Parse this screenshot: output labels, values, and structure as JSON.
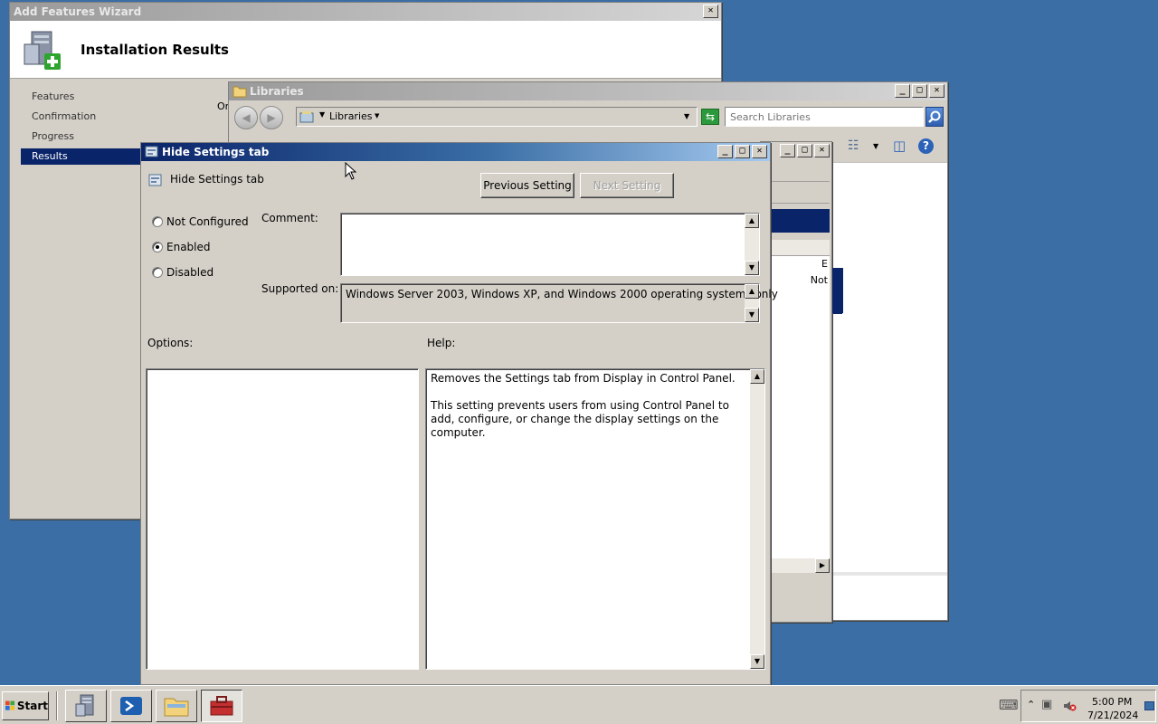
{
  "wizard": {
    "title": "Add Features Wizard",
    "heading": "Installation Results",
    "nav": [
      "Features",
      "Confirmation",
      "Progress",
      "Results"
    ],
    "selected_index": 3,
    "partial_text": "Or"
  },
  "libraries": {
    "title": "Libraries",
    "address_crumb": "Libraries",
    "search_placeholder": "Search Libraries"
  },
  "back_window": {
    "col_text_e": "E",
    "col_text_not": "Not"
  },
  "policy": {
    "title": "Hide Settings tab",
    "setting_name": "Hide Settings tab",
    "prev_button": "Previous Setting",
    "next_button": "Next Setting",
    "radio_options": [
      "Not Configured",
      "Enabled",
      "Disabled"
    ],
    "selected_option": "Enabled",
    "comment_label": "Comment:",
    "comment_value": "",
    "supported_label": "Supported on:",
    "supported_value": "Windows Server 2003, Windows XP, and Windows 2000 operating systems only",
    "options_label": "Options:",
    "help_label": "Help:",
    "help_line1": "Removes the Settings tab from Display in Control Panel.",
    "help_line2": "This setting prevents users from using Control Panel to add, configure, or change the display settings on the computer."
  },
  "taskbar": {
    "start_label": "Start",
    "clock_time": "5:00 PM",
    "clock_date": "7/21/2024"
  },
  "colors": {
    "desktop": "#3a6ea5",
    "selection": "#0a246a",
    "chrome": "#d4d0c8"
  }
}
